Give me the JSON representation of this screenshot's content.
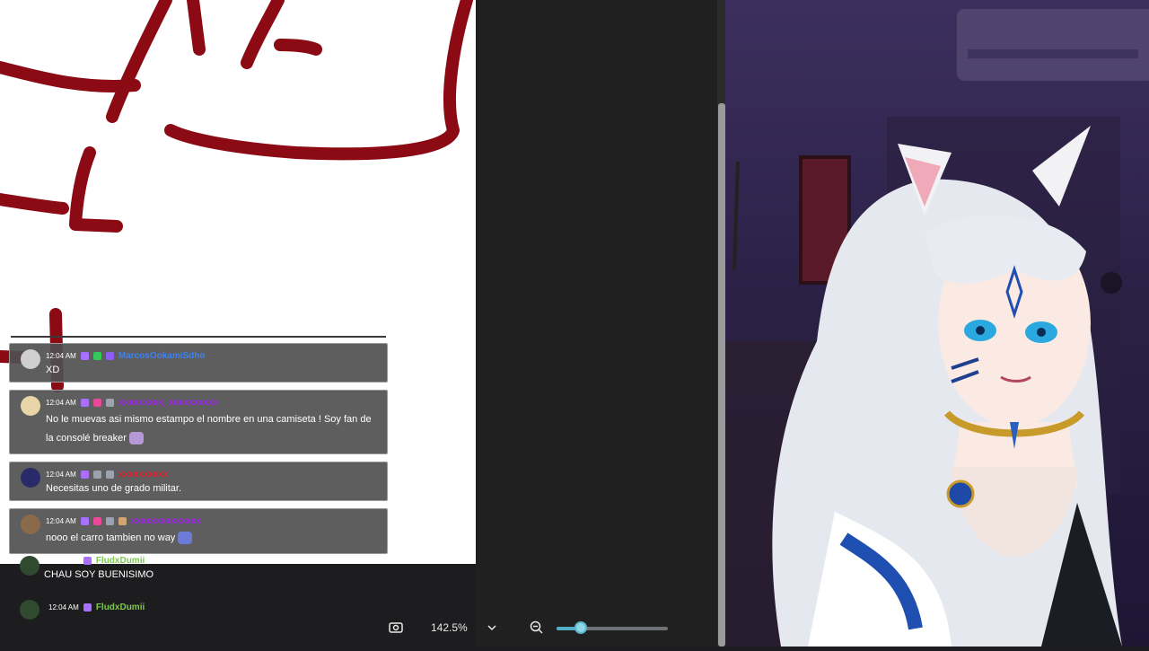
{
  "viewer": {
    "zoom_label": "142.5%"
  },
  "chat": {
    "messages": [
      {
        "time": "12:04 AM",
        "user": "MarcosOokamiSdho",
        "user_color": "#3b82f6",
        "text": "XD"
      },
      {
        "time": "12:04 AM",
        "user": "xxxxxxxxx_xxxxxxxxxx",
        "user_color": "#a020f0",
        "text_line1": "No le muevas asi mismo estampo el nombre en una camiseta ! Soy fan de",
        "text_line2": "la consolé breaker"
      },
      {
        "time": "12:04 AM",
        "user": "xxxxxxxxxx",
        "user_color": "#e11d2e",
        "text": "Necesitas uno de grado militar."
      },
      {
        "time": "12:04 AM",
        "user": "xxxxxxxxxxxxxx",
        "user_color": "#a020f0",
        "text": "nooo el carro tambien no way"
      },
      {
        "time": "12:04 AM",
        "user": "FludxDumii",
        "user_color": "#7ec850",
        "text": "CHAU SOY BUENISIMO"
      },
      {
        "time": "12:04 AM",
        "user": "FludxDumii",
        "user_color": "#7ec850",
        "text": ""
      }
    ]
  },
  "icons": {
    "screenshot": "screenshot-icon",
    "zoom_out": "zoom-out-icon",
    "chevron": "chevron-down-icon"
  },
  "colors": {
    "ink": "#8b0a14",
    "slider": "#4fb0c6",
    "chat_bg": "#505050"
  }
}
